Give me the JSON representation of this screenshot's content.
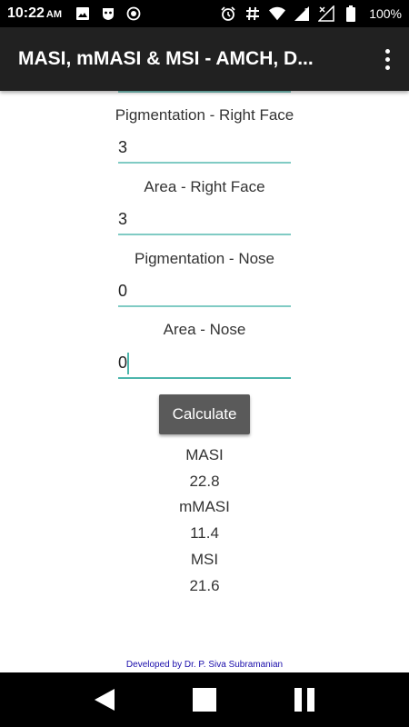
{
  "status_bar": {
    "time": "10:22",
    "ampm": "AM",
    "battery": "100%",
    "icons_left": [
      "image-icon",
      "shield-icon",
      "record-icon"
    ],
    "icons_right": [
      "alarm-icon",
      "hash-icon",
      "wifi-icon",
      "signal-r-icon",
      "signal-x-icon",
      "battery-icon"
    ]
  },
  "app_bar": {
    "title": "MASI, mMASI & MSI - AMCH, D..."
  },
  "fields": [
    {
      "label": "Pigmentation - Right Face",
      "value": "3"
    },
    {
      "label": "Area - Right Face",
      "value": "3"
    },
    {
      "label": "Pigmentation - Nose",
      "value": "0"
    },
    {
      "label": "Area - Nose",
      "value": "0"
    }
  ],
  "calculate_label": "Calculate",
  "results": {
    "masi_label": "MASI",
    "masi_value": "22.8",
    "mmasi_label": "mMASI",
    "mmasi_value": "11.4",
    "msi_label": "MSI",
    "msi_value": "21.6"
  },
  "footer": "Developed by Dr. P. Siva Subramanian",
  "colors": {
    "accent": "#80cbc4",
    "app_bar": "#212121",
    "button": "#5a5a5a",
    "link": "#1a0dab"
  }
}
